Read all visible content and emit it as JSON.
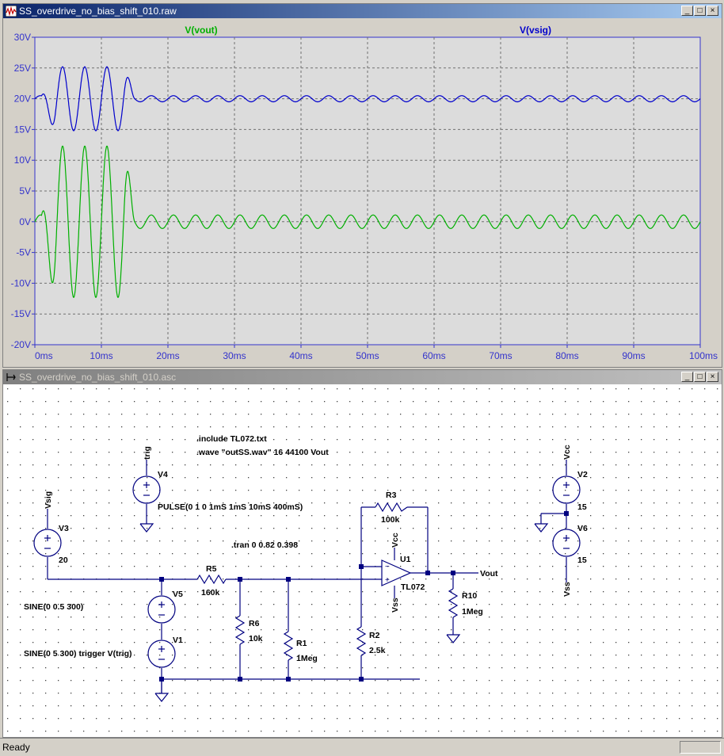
{
  "waveform_window": {
    "title": "SS_overdrive_no_bias_shift_010.raw",
    "buttons": {
      "minimize": "_",
      "maximize": "□",
      "close": "×"
    }
  },
  "schematic_window": {
    "title": "SS_overdrive_no_bias_shift_010.asc",
    "buttons": {
      "minimize": "_",
      "maximize": "□",
      "close": "×"
    }
  },
  "status": {
    "text": "Ready"
  },
  "colors": {
    "vout": "#00b000",
    "vsig": "#0000cc",
    "axis": "#3333cc",
    "plot_bg": "#dcdcdc",
    "schematic_bg": "#ffffff",
    "wire": "#000080"
  },
  "chart_data": {
    "type": "line",
    "xlim": [
      0,
      100
    ],
    "ylim": [
      -20,
      30
    ],
    "x_ticks": [
      "0ms",
      "10ms",
      "20ms",
      "30ms",
      "40ms",
      "50ms",
      "60ms",
      "70ms",
      "80ms",
      "90ms",
      "100ms"
    ],
    "y_ticks": [
      "30V",
      "25V",
      "20V",
      "15V",
      "10V",
      "5V",
      "0V",
      "-5V",
      "-10V",
      "-15V",
      "-20V"
    ],
    "grid": true,
    "series": [
      {
        "name": "V(vout)",
        "color": "#00b000",
        "offset": 0,
        "burst_amplitude": 12.3,
        "burst_end_ms": 13.5,
        "steady_amplitude": 1.1,
        "frequency_hz": 300
      },
      {
        "name": "V(vsig)",
        "color": "#0000cc",
        "offset": 20,
        "burst_amplitude": 5.2,
        "burst_end_ms": 13.5,
        "steady_amplitude": 0.5,
        "frequency_hz": 300
      }
    ]
  },
  "schematic": {
    "directives": [
      ".include TL072.txt",
      ".wave \"outSS.wav\" 16 44100 Vout",
      ".tran 0 0.82 0.398"
    ],
    "labels": {
      "vsig": "Vsig",
      "trig": "trig",
      "vcc_u1": "Vcc",
      "vss_u1": "Vss",
      "vcc": "Vcc",
      "vss": "Vss",
      "vout": "Vout",
      "v1": "V1",
      "v2": "V2",
      "v3": "V3",
      "v4": "V4",
      "v5": "V5",
      "v6": "V6",
      "v3_val": "20",
      "v2_val": "15",
      "v6_val": "15",
      "v4_val": "PULSE(0 1 0 1mS 1mS 10mS 400mS)",
      "v5_val": "SINE(0 0.5 300)",
      "v1_val": "SINE(0 5 300) trigger V(trig)",
      "r1": "R1",
      "r1_val": "1Meg",
      "r2": "R2",
      "r2_val": "2.5k",
      "r3": "R3",
      "r3_val": "100k",
      "r5": "R5",
      "r5_val": "160k",
      "r6": "R6",
      "r6_val": "10k",
      "r10": "R10",
      "r10_val": "1Meg",
      "u1": "U1",
      "u1_val": "TL072"
    }
  }
}
